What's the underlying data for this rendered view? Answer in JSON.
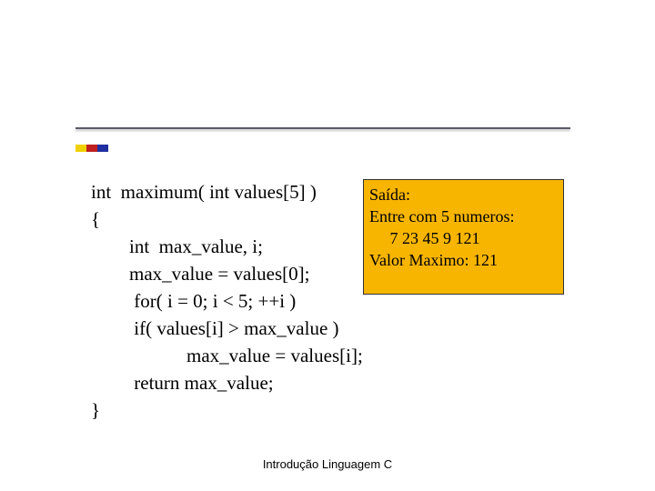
{
  "code": {
    "l1": "int  maximum( int values[5] )",
    "l2": "{",
    "l3": "        int  max_value, i;",
    "l4": "        max_value = values[0];",
    "l5": "         for( i = 0; i < 5; ++i )",
    "l6": "         if( values[i] > max_value )",
    "l7": "                    max_value = values[i];",
    "l8": "         return max_value;",
    "l9": "}"
  },
  "output": {
    "l1": "Saída:",
    "l2": "",
    "l3": "Entre com 5 numeros:",
    "l4": "     7 23 45 9 121",
    "l5": "Valor Maximo: 121"
  },
  "footer": "Introdução Linguagem C"
}
